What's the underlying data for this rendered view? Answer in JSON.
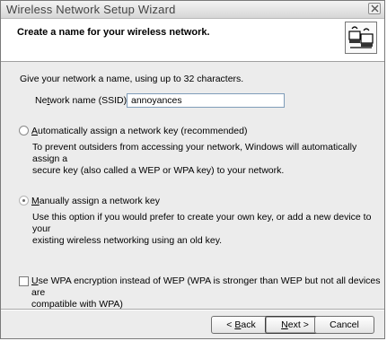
{
  "window": {
    "title": "Wireless Network Setup Wizard",
    "close_icon": "close-icon"
  },
  "header": {
    "title": "Create a name for your wireless network.",
    "icon": "wireless-wizard-icon"
  },
  "intro": "Give your network a name, using up to 32 characters.",
  "ssid": {
    "label_pre": "Ne",
    "label_accel": "t",
    "label_post": "work name (SSID):",
    "value": "annoyances"
  },
  "auto_key": {
    "label_pre": "",
    "label_accel": "A",
    "label_post": "utomatically assign a network key (recommended)",
    "description_line1": "To prevent outsiders from accessing your network, Windows will automatically assign a",
    "description_line2": "secure key (also called a WEP or WPA key) to your network.",
    "selected": false
  },
  "manual_key": {
    "label_pre": "",
    "label_accel": "M",
    "label_post": "anually assign a network key",
    "description_line1": "Use this option if you would prefer to create your own key, or add a new device to your",
    "description_line2": "existing wireless networking using an old key.",
    "selected": true
  },
  "wpa": {
    "label_pre": "",
    "label_accel": "U",
    "label_post": "se WPA encryption instead of WEP (WPA is stronger than WEP but not all devices are",
    "label_line2": "compatible with WPA)",
    "checked": false
  },
  "buttons": {
    "back_pre": "< ",
    "back_accel": "B",
    "back_post": "ack",
    "next_pre": "",
    "next_accel": "N",
    "next_post": "ext >",
    "cancel": "Cancel"
  }
}
